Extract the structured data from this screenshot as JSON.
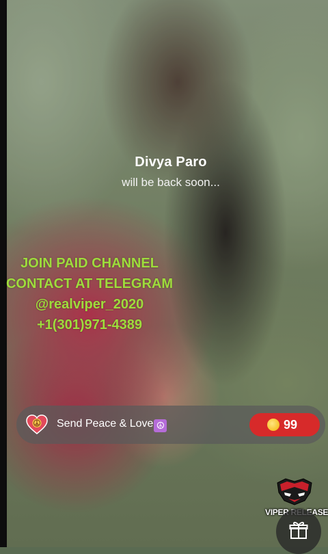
{
  "host": {
    "name": "Divya Paro",
    "status": "will be back soon..."
  },
  "promo_lines": [
    "JOIN PAID CHANNEL",
    "CONTACT AT TELEGRAM",
    "@realviper_2020",
    "+1(301)971-4389"
  ],
  "gift_bar": {
    "label": "Send Peace & Love",
    "peace_glyph": "☮",
    "coin_count": "99",
    "icons": {
      "heart": "peace-heart-icon",
      "coin": "coin-icon"
    }
  },
  "watermark": {
    "text": "VIPER RELEASE",
    "icon": "viper-mascot-logo"
  },
  "gift_button": {
    "icon": "gift-icon"
  },
  "colors": {
    "promo_text": "#9edc3c",
    "coin_button": "#d72a2a",
    "gift_bar_bg": "rgba(90,90,90,0.72)"
  }
}
